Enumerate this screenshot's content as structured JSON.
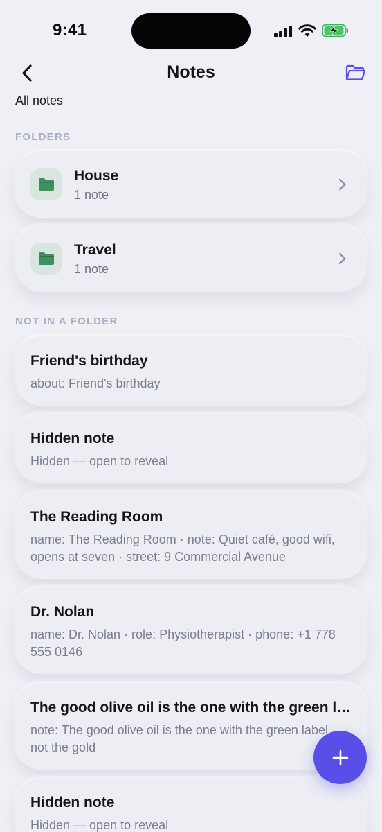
{
  "status_bar": {
    "time": "9:41"
  },
  "nav": {
    "title": "Notes"
  },
  "breadcrumb": "All notes",
  "sections": {
    "folders": "FOLDERS",
    "not_in_folder": "NOT IN A FOLDER"
  },
  "folders": [
    {
      "name": "House",
      "count": "1 note"
    },
    {
      "name": "Travel",
      "count": "1 note"
    }
  ],
  "notes": [
    {
      "title": "Friend's birthday",
      "preview": "about: Friend's birthday"
    },
    {
      "title": "Hidden note",
      "preview": "Hidden — open to reveal"
    },
    {
      "title": "The Reading Room",
      "preview": "name: The Reading Room · note: Quiet café, good wifi, opens at seven · street: 9 Commercial Avenue"
    },
    {
      "title": "Dr. Nolan",
      "preview": "name: Dr. Nolan · role: Physiotherapist · phone: +1 778 555 0146"
    },
    {
      "title": "The good olive oil is the one with the green lab…",
      "preview": "note: The good olive oil is the one with the green label, not the gold"
    },
    {
      "title": "Hidden note",
      "preview": "Hidden — open to reveal"
    }
  ],
  "colors": {
    "accent": "#5a4ee8",
    "folder_green": "#3f8f5f",
    "background": "#eef0f5"
  },
  "icons": {
    "back": "chevron-left-icon",
    "folders": "folder-open-icon",
    "folder": "folder-icon",
    "add": "plus-icon"
  }
}
